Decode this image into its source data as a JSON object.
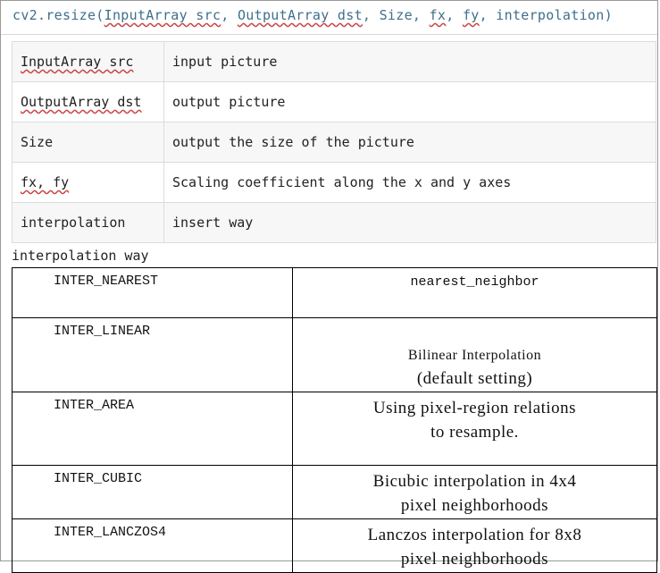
{
  "signature": {
    "prefix": "cv2.resize(",
    "args": [
      "InputArray src",
      "OutputArray dst",
      "Size",
      "fx",
      "fy",
      "interpolation"
    ],
    "suffix": ")"
  },
  "params": [
    {
      "name": "InputArray src",
      "desc": "input picture"
    },
    {
      "name": "OutputArray dst",
      "desc": "output picture"
    },
    {
      "name": "Size",
      "desc": "output the size of the picture"
    },
    {
      "name": "fx, fy",
      "desc": "Scaling coefficient along the x and y axes"
    },
    {
      "name": "interpolation",
      "desc": "insert way"
    }
  ],
  "caption": "interpolation way",
  "methods": [
    {
      "flag": "INTER_NEAREST",
      "line1": "nearest_neighbor",
      "line2": ""
    },
    {
      "flag": "INTER_LINEAR",
      "line1": "Bilinear Interpolation",
      "line2": "(default setting)"
    },
    {
      "flag": "INTER_AREA",
      "line1": "Using pixel-region relations",
      "line2": "to resample."
    },
    {
      "flag": "INTER_CUBIC",
      "line1": "Bicubic interpolation in 4x4",
      "line2": "pixel neighborhoods"
    },
    {
      "flag": "INTER_LANCZOS4",
      "line1": "Lanczos interpolation for 8x8",
      "line2": "pixel neighborhoods"
    }
  ]
}
